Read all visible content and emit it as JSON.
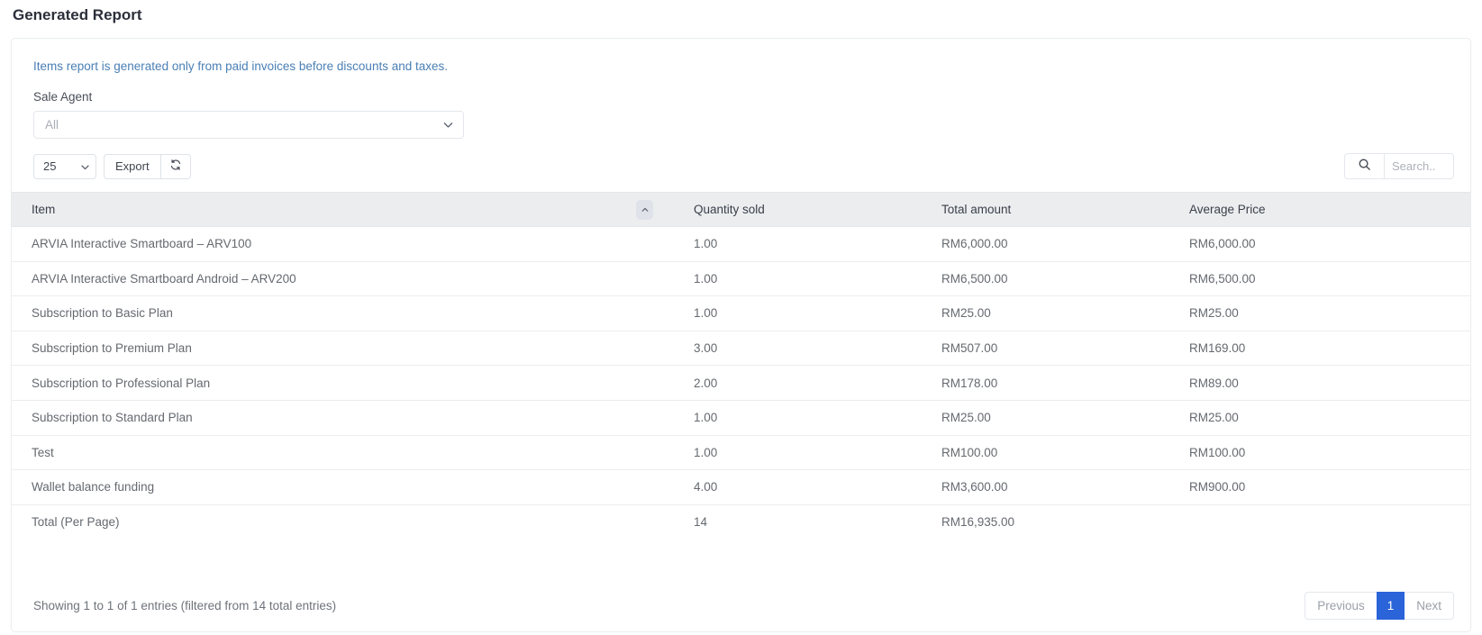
{
  "page_title": "Generated Report",
  "notice": "Items report is generated only from paid invoices before discounts and taxes.",
  "filter": {
    "label": "Sale Agent",
    "value": "All"
  },
  "toolbar": {
    "page_length": "25",
    "export_label": "Export",
    "refresh_icon": "refresh-icon",
    "search_icon": "search-icon",
    "search_value": "",
    "search_placeholder": "Search.."
  },
  "table": {
    "columns": [
      {
        "label": "Item",
        "sorted": "asc"
      },
      {
        "label": "Quantity sold"
      },
      {
        "label": "Total amount"
      },
      {
        "label": "Average Price"
      }
    ],
    "rows": [
      {
        "item": "ARVIA Interactive Smartboard – ARV100",
        "qty": "1.00",
        "total": "RM6,000.00",
        "avg": "RM6,000.00"
      },
      {
        "item": "ARVIA Interactive Smartboard Android – ARV200",
        "qty": "1.00",
        "total": "RM6,500.00",
        "avg": "RM6,500.00"
      },
      {
        "item": "Subscription to Basic Plan",
        "qty": "1.00",
        "total": "RM25.00",
        "avg": "RM25.00"
      },
      {
        "item": "Subscription to Premium Plan",
        "qty": "3.00",
        "total": "RM507.00",
        "avg": "RM169.00"
      },
      {
        "item": "Subscription to Professional Plan",
        "qty": "2.00",
        "total": "RM178.00",
        "avg": "RM89.00"
      },
      {
        "item": "Subscription to Standard Plan",
        "qty": "1.00",
        "total": "RM25.00",
        "avg": "RM25.00"
      },
      {
        "item": "Test",
        "qty": "1.00",
        "total": "RM100.00",
        "avg": "RM100.00"
      },
      {
        "item": "Wallet balance funding",
        "qty": "4.00",
        "total": "RM3,600.00",
        "avg": "RM900.00"
      }
    ],
    "total_row": {
      "item": "Total (Per Page)",
      "qty": "14",
      "total": "RM16,935.00",
      "avg": ""
    }
  },
  "footer": {
    "showing": "Showing 1 to 1 of 1 entries (filtered from 14 total entries)",
    "previous_label": "Previous",
    "page_label": "1",
    "next_label": "Next"
  },
  "colors": {
    "accent": "#2b63d9",
    "notice_text": "#4a7fb5",
    "header_bg": "#ebedef"
  }
}
